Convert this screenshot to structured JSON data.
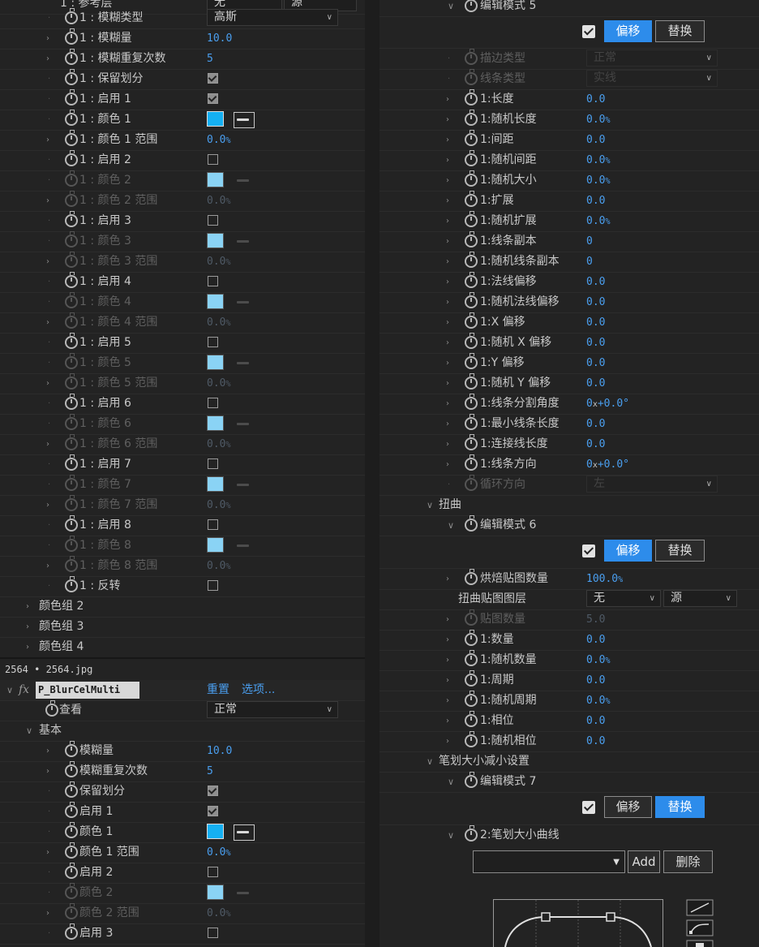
{
  "left": {
    "top_partial": {
      "label": "1 : 参考层",
      "sel1": "无",
      "sel2": "源"
    },
    "rows": [
      {
        "type": "select",
        "label": "1 : 模糊类型",
        "value": "高斯",
        "tw": "none"
      },
      {
        "type": "value",
        "label": "1 : 模糊量",
        "value": "10.0",
        "tw": "right"
      },
      {
        "type": "value",
        "label": "1 : 模糊重复次数",
        "value": "5",
        "tw": "right"
      },
      {
        "type": "check",
        "label": "1 : 保留划分",
        "checked": true,
        "tw": "none"
      },
      {
        "type": "check",
        "label": "1 : 启用 1",
        "checked": true,
        "tw": "none"
      },
      {
        "type": "color",
        "label": "1 : 颜色 1",
        "tw": "none"
      },
      {
        "type": "value",
        "label": "1 : 颜色 1 范围",
        "value": "0.0",
        "unit": "%",
        "tw": "right"
      },
      {
        "type": "check",
        "label": "1 : 启用 2",
        "checked": false,
        "tw": "none"
      },
      {
        "type": "color",
        "label": "1 : 颜色 2",
        "disabled": true,
        "tw": "none"
      },
      {
        "type": "value",
        "label": "1 : 颜色 2 范围",
        "value": "0.0",
        "unit": "%",
        "disabled": true,
        "tw": "right"
      },
      {
        "type": "check",
        "label": "1 : 启用 3",
        "checked": false,
        "tw": "none"
      },
      {
        "type": "color",
        "label": "1 : 颜色 3",
        "disabled": true,
        "tw": "none"
      },
      {
        "type": "value",
        "label": "1 : 颜色 3 范围",
        "value": "0.0",
        "unit": "%",
        "disabled": true,
        "tw": "right"
      },
      {
        "type": "check",
        "label": "1 : 启用 4",
        "checked": false,
        "tw": "none"
      },
      {
        "type": "color",
        "label": "1 : 颜色 4",
        "disabled": true,
        "tw": "none"
      },
      {
        "type": "value",
        "label": "1 : 颜色 4 范围",
        "value": "0.0",
        "unit": "%",
        "disabled": true,
        "tw": "right"
      },
      {
        "type": "check",
        "label": "1 : 启用 5",
        "checked": false,
        "tw": "none"
      },
      {
        "type": "color",
        "label": "1 : 颜色 5",
        "disabled": true,
        "tw": "none"
      },
      {
        "type": "value",
        "label": "1 : 颜色 5 范围",
        "value": "0.0",
        "unit": "%",
        "disabled": true,
        "tw": "right"
      },
      {
        "type": "check",
        "label": "1 : 启用 6",
        "checked": false,
        "tw": "none"
      },
      {
        "type": "color",
        "label": "1 : 颜色 6",
        "disabled": true,
        "tw": "none"
      },
      {
        "type": "value",
        "label": "1 : 颜色 6 范围",
        "value": "0.0",
        "unit": "%",
        "disabled": true,
        "tw": "right"
      },
      {
        "type": "check",
        "label": "1 : 启用 7",
        "checked": false,
        "tw": "none"
      },
      {
        "type": "color",
        "label": "1 : 颜色 7",
        "disabled": true,
        "tw": "none"
      },
      {
        "type": "value",
        "label": "1 : 颜色 7 范围",
        "value": "0.0",
        "unit": "%",
        "disabled": true,
        "tw": "right"
      },
      {
        "type": "check",
        "label": "1 : 启用 8",
        "checked": false,
        "tw": "none"
      },
      {
        "type": "color",
        "label": "1 : 颜色 8",
        "disabled": true,
        "tw": "none"
      },
      {
        "type": "value",
        "label": "1 : 颜色 8 范围",
        "value": "0.0",
        "unit": "%",
        "disabled": true,
        "tw": "right"
      },
      {
        "type": "check",
        "label": "1 : 反转",
        "checked": false,
        "tw": "none"
      }
    ],
    "groups": [
      "颜色组 2",
      "颜色组 3",
      "颜色组 4"
    ],
    "file_label": "2564 • 2564.jpg",
    "effect": {
      "fx": "fx",
      "name": "P_BlurCelMulti",
      "reset": "重置",
      "options": "选项..."
    },
    "view": {
      "label": "查看",
      "value": "正常"
    },
    "basic_group": "基本",
    "rows2": [
      {
        "type": "value",
        "label": "模糊量",
        "value": "10.0",
        "tw": "right"
      },
      {
        "type": "value",
        "label": "模糊重复次数",
        "value": "5",
        "tw": "right"
      },
      {
        "type": "check",
        "label": "保留划分",
        "checked": true,
        "tw": "none"
      },
      {
        "type": "check",
        "label": "启用 1",
        "checked": true,
        "tw": "none"
      },
      {
        "type": "color",
        "label": "颜色 1",
        "tw": "none"
      },
      {
        "type": "value",
        "label": "颜色 1 范围",
        "value": "0.0",
        "unit": "%",
        "tw": "right"
      },
      {
        "type": "check",
        "label": "启用 2",
        "checked": false,
        "tw": "none"
      },
      {
        "type": "color",
        "label": "颜色 2",
        "disabled": true,
        "tw": "none"
      },
      {
        "type": "value",
        "label": "颜色 2 范围",
        "value": "0.0",
        "unit": "%",
        "disabled": true,
        "tw": "right"
      },
      {
        "type": "check",
        "label": "启用 3",
        "checked": false,
        "tw": "none"
      }
    ]
  },
  "right": {
    "edit5": {
      "label": "编辑模式 5",
      "offset": "偏移",
      "replace": "替换"
    },
    "rows": [
      {
        "type": "select",
        "label": "描边类型",
        "value": "正常",
        "disabled": true
      },
      {
        "type": "select",
        "label": "线条类型",
        "value": "实线",
        "disabled": true
      },
      {
        "type": "value",
        "label": "1:长度",
        "value": "0.0"
      },
      {
        "type": "value",
        "label": "1:随机长度",
        "value": "0.0",
        "unit": "%"
      },
      {
        "type": "value",
        "label": "1:间距",
        "value": "0.0"
      },
      {
        "type": "value",
        "label": "1:随机间距",
        "value": "0.0",
        "unit": "%"
      },
      {
        "type": "value",
        "label": "1:随机大小",
        "value": "0.0",
        "unit": "%"
      },
      {
        "type": "value",
        "label": "1:扩展",
        "value": "0.0"
      },
      {
        "type": "value",
        "label": "1:随机扩展",
        "value": "0.0",
        "unit": "%"
      },
      {
        "type": "value",
        "label": "1:线条副本",
        "value": "0"
      },
      {
        "type": "value",
        "label": "1:随机线条副本",
        "value": "0"
      },
      {
        "type": "value",
        "label": "1:法线偏移",
        "value": "0.0"
      },
      {
        "type": "value",
        "label": "1:随机法线偏移",
        "value": "0.0"
      },
      {
        "type": "value",
        "label": "1:X 偏移",
        "value": "0.0"
      },
      {
        "type": "value",
        "label": "1:随机 X 偏移",
        "value": "0.0"
      },
      {
        "type": "value",
        "label": "1:Y 偏移",
        "value": "0.0"
      },
      {
        "type": "value",
        "label": "1:随机 Y 偏移",
        "value": "0.0"
      },
      {
        "type": "angle",
        "label": "1:线条分割角度",
        "value": "0",
        "mid": "x",
        "value2": "+0.0",
        "unit": "°"
      },
      {
        "type": "value",
        "label": "1:最小线条长度",
        "value": "0.0"
      },
      {
        "type": "value",
        "label": "1:连接线长度",
        "value": "0.0"
      },
      {
        "type": "angle",
        "label": "1:线条方向",
        "value": "0",
        "mid": "x",
        "value2": "+0.0",
        "unit": "°"
      },
      {
        "type": "select",
        "label": "循环方向",
        "value": "左",
        "disabled": true
      }
    ],
    "distort_group": "扭曲",
    "edit6": {
      "label": "编辑模式 6",
      "offset": "偏移",
      "replace": "替换"
    },
    "bake_row": {
      "label": "烘焙贴图数量",
      "value": "100.0",
      "unit": "%"
    },
    "distort_layer": {
      "label": "扭曲贴图图层",
      "sel1": "无",
      "sel2": "源"
    },
    "rows2": [
      {
        "type": "value",
        "label": "贴图数量",
        "value": "5.0",
        "disabled": true
      },
      {
        "type": "value",
        "label": "1:数量",
        "value": "0.0"
      },
      {
        "type": "value",
        "label": "1:随机数量",
        "value": "0.0",
        "unit": "%"
      },
      {
        "type": "value",
        "label": "1:周期",
        "value": "0.0"
      },
      {
        "type": "value",
        "label": "1:随机周期",
        "value": "0.0",
        "unit": "%"
      },
      {
        "type": "value",
        "label": "1:相位",
        "value": "0.0"
      },
      {
        "type": "value",
        "label": "1:随机相位",
        "value": "0.0"
      }
    ],
    "taper_group": "笔划大小减小设置",
    "edit7": {
      "label": "编辑模式 7",
      "offset": "偏移",
      "replace": "替换"
    },
    "curve": {
      "label": "2:笔划大小曲线",
      "add": "Add",
      "delete": "删除"
    }
  }
}
